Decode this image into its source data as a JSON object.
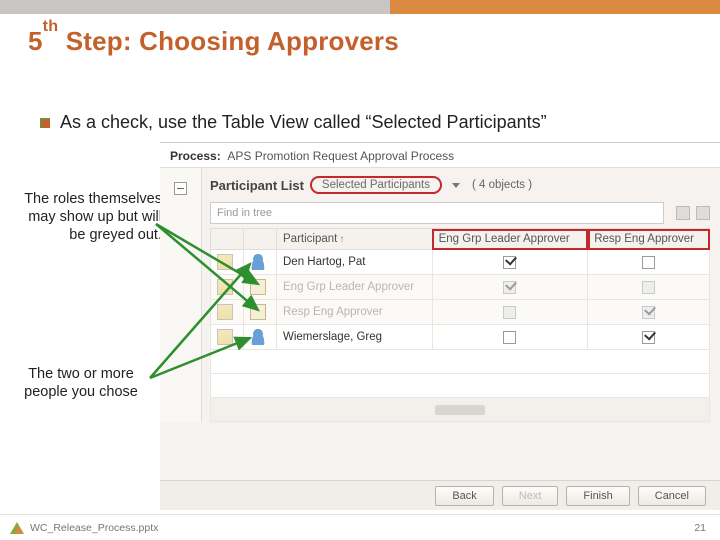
{
  "slide": {
    "step_number": "5",
    "step_suffix": "th",
    "title_rest": " Step: Choosing Approvers",
    "bullet": "As a check, use the Table View called “Selected Participants”",
    "note_roles": "The roles themselves may show up but will be greyed out.",
    "note_people": "The two or more people you chose",
    "footer_file": "WC_Release_Process.pptx",
    "page_number": "21"
  },
  "app": {
    "process_label": "Process:",
    "process_name": "APS Promotion Request Approval Process",
    "panel_title": "Participant List",
    "view_name": "Selected Participants",
    "object_count": "( 4 objects )",
    "find_placeholder": "Find in tree",
    "columns": {
      "participant": "Participant",
      "col_a": "Eng Grp Leader Approver",
      "col_b": "Resp Eng Approver"
    },
    "rows": [
      {
        "type": "person",
        "name": "Den Hartog, Pat",
        "a": "on",
        "b": "off"
      },
      {
        "type": "role",
        "name": "Eng Grp Leader Approver",
        "a": "on-disabled",
        "b": "off-disabled"
      },
      {
        "type": "role",
        "name": "Resp Eng Approver",
        "a": "off-disabled",
        "b": "on-disabled"
      },
      {
        "type": "person",
        "name": "Wiemerslage, Greg",
        "a": "off",
        "b": "on"
      }
    ],
    "buttons": {
      "back": "Back",
      "next": "Next",
      "finish": "Finish",
      "cancel": "Cancel"
    }
  }
}
